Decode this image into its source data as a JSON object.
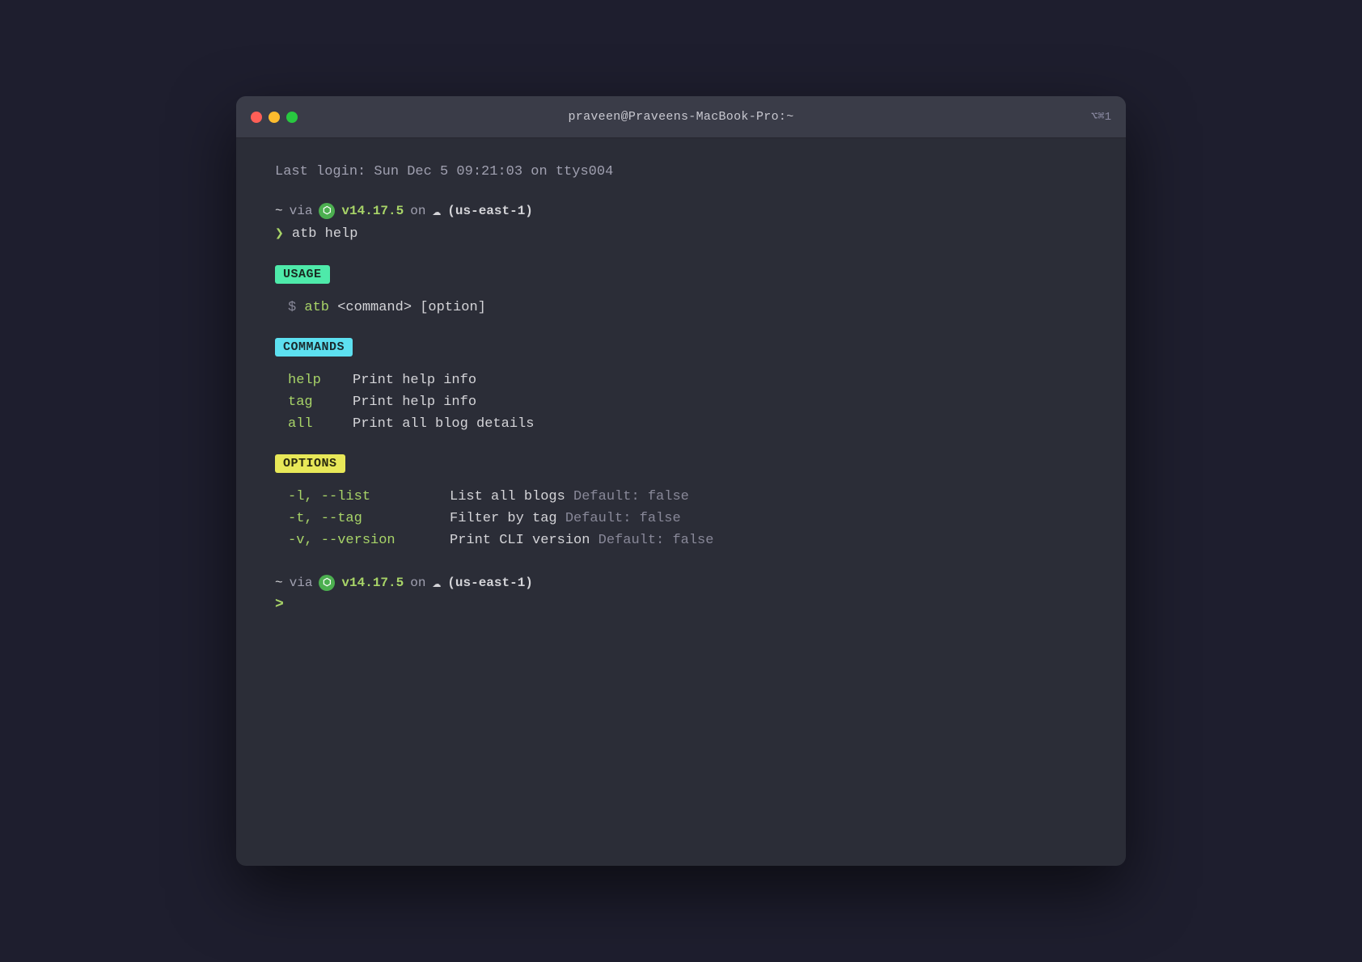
{
  "window": {
    "title": "praveen@Praveens-MacBook-Pro:~",
    "shortcut": "⌥⌘1"
  },
  "terminal": {
    "login_line": "Last login: Sun Dec  5 09:21:03 on ttys004",
    "prompt1": {
      "tilde": "~",
      "via": "via",
      "version": "v14.17.5",
      "on": "on",
      "cloud": "☁",
      "region": "(us-east-1)"
    },
    "command_input": "atb help",
    "usage_badge": "USAGE",
    "usage_example": "$ atb <command> [option]",
    "commands_badge": "COMMANDS",
    "commands": [
      {
        "name": "help",
        "desc": "Print help info"
      },
      {
        "name": "tag",
        "desc": "Print help info"
      },
      {
        "name": "all",
        "desc": "Print all blog details"
      }
    ],
    "options_badge": "OPTIONS",
    "options": [
      {
        "name": "-l, --list",
        "desc": "List all blogs ",
        "default": "Default: false"
      },
      {
        "name": "-t, --tag",
        "desc": "Filter by tag ",
        "default": "Default: false"
      },
      {
        "name": "-v, --version",
        "desc": "Print CLI version ",
        "default": "Default: false"
      }
    ],
    "prompt2": {
      "tilde": "~",
      "via": "via",
      "version": "v14.17.5",
      "on": "on",
      "cloud": "☁",
      "region": "(us-east-1)"
    },
    "chevron": ">",
    "node_symbol": "⬡"
  },
  "colors": {
    "green_text": "#a8d468",
    "cyan_badge": "#5de0f0",
    "green_badge": "#4eeaaa",
    "yellow_badge": "#e8e858",
    "muted": "#888898"
  }
}
